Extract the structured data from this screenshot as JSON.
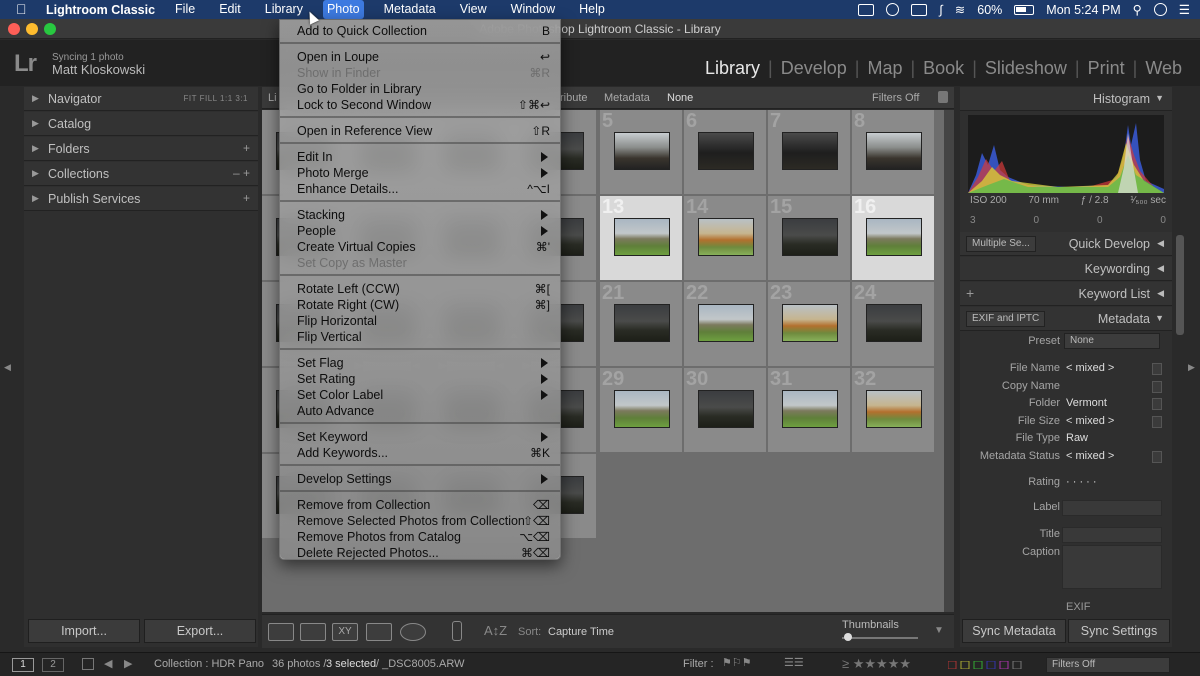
{
  "menubar": {
    "app": "Lightroom Classic",
    "items": [
      "File",
      "Edit",
      "Library",
      "Photo",
      "Metadata",
      "View",
      "Window",
      "Help"
    ],
    "battery": "60%",
    "clock": "Mon 5:24 PM"
  },
  "window": {
    "title": "Adobe Photoshop Lightroom Classic - Library"
  },
  "identity": {
    "logo": "Lr",
    "sync_status": "Syncing 1 photo",
    "user": "Matt Kloskowski"
  },
  "modules": [
    "Library",
    "Develop",
    "Map",
    "Book",
    "Slideshow",
    "Print",
    "Web"
  ],
  "left_panel": {
    "navigator": {
      "label": "Navigator",
      "zoom_options": "FIT   FILL   1:1   3:1"
    },
    "sections": [
      {
        "label": "Catalog",
        "extra": ""
      },
      {
        "label": "Folders",
        "extra": "+"
      },
      {
        "label": "Collections",
        "extra": "–  +"
      },
      {
        "label": "Publish Services",
        "extra": "+"
      }
    ],
    "import_label": "Import...",
    "export_label": "Export..."
  },
  "filter_bar": {
    "metadata_label": "Metadata",
    "none_label": "None",
    "filters_off": "Filters Off",
    "attribute_label": "ribute",
    "library_label": "Li"
  },
  "grid": {
    "cells": [
      {
        "n": "5",
        "t": "t-river",
        "sel": false
      },
      {
        "n": "6",
        "t": "t-dark",
        "sel": false
      },
      {
        "n": "7",
        "t": "t-dark",
        "sel": false
      },
      {
        "n": "8",
        "t": "t-river",
        "sel": false
      },
      {
        "n": "13",
        "t": "t-hill",
        "sel": true
      },
      {
        "n": "14",
        "t": "t-autumn",
        "sel": false
      },
      {
        "n": "15",
        "t": "t-dusk",
        "sel": false
      },
      {
        "n": "16",
        "t": "t-hill",
        "sel": true
      },
      {
        "n": "21",
        "t": "t-dusk",
        "sel": false
      },
      {
        "n": "22",
        "t": "t-hill",
        "sel": false
      },
      {
        "n": "23",
        "t": "t-autumn",
        "sel": false
      },
      {
        "n": "24",
        "t": "t-dusk",
        "sel": false
      },
      {
        "n": "29",
        "t": "t-hill",
        "sel": false
      },
      {
        "n": "30",
        "t": "t-dusk",
        "sel": false
      },
      {
        "n": "31",
        "t": "t-hill",
        "sel": false
      },
      {
        "n": "32",
        "t": "t-autumn",
        "sel": false
      }
    ]
  },
  "toolbar": {
    "sort_label": "Sort:",
    "sort_value": "Capture Time",
    "thumbnails_label": "Thumbnails"
  },
  "right_panel": {
    "histogram_label": "Histogram",
    "histo_info": {
      "iso": "ISO 200",
      "focal": "70 mm",
      "aperture": "ƒ / 2.8",
      "shutter": "¹⁄₅₀₀ sec"
    },
    "histo_counts": [
      "3",
      "0",
      "0",
      "0"
    ],
    "preset_select": "Multiple Se...",
    "quick_develop": "Quick Develop",
    "keywording": "Keywording",
    "keyword_list": "Keyword List",
    "metadata_select": "EXIF and IPTC",
    "metadata_label": "Metadata",
    "preset_label": "Preset",
    "preset_value": "None",
    "fields": [
      {
        "k": "File Name",
        "v": "< mixed >"
      },
      {
        "k": "Copy Name",
        "v": ""
      },
      {
        "k": "Folder",
        "v": "Vermont"
      },
      {
        "k": "File Size",
        "v": "< mixed >"
      },
      {
        "k": "File Type",
        "v": "Raw"
      },
      {
        "k": "Metadata Status",
        "v": "< mixed >"
      }
    ],
    "rating_label": "Rating",
    "rating_value": "·  ·  ·  ·  ·",
    "label_label": "Label",
    "title_label": "Title",
    "caption_label": "Caption",
    "exif_label": "EXIF",
    "sync_metadata": "Sync Metadata",
    "sync_settings": "Sync Settings"
  },
  "filmstrip": {
    "view1": "1",
    "view2": "2",
    "source": "Collection : HDR Pano",
    "count": "36 photos /",
    "selected": "3 selected",
    "file": "/ _DSC8005.ARW",
    "filter_label": "Filter :",
    "filters_off": "Filters Off"
  },
  "photo_menu": {
    "items": [
      {
        "label": "Add to Quick Collection",
        "shortcut": "B",
        "disabled": false,
        "sub": false,
        "sep_after": true
      },
      {
        "label": "Open in Loupe",
        "shortcut": "↩",
        "disabled": false,
        "sub": false,
        "sep_after": false
      },
      {
        "label": "Show in Finder",
        "shortcut": "⌘R",
        "disabled": true,
        "sub": false,
        "sep_after": false
      },
      {
        "label": "Go to Folder in Library",
        "shortcut": "",
        "disabled": false,
        "sub": false,
        "sep_after": false
      },
      {
        "label": "Lock to Second Window",
        "shortcut": "⇧⌘↩",
        "disabled": false,
        "sub": false,
        "sep_after": true
      },
      {
        "label": "Open in Reference View",
        "shortcut": "⇧R",
        "disabled": false,
        "sub": false,
        "sep_after": true
      },
      {
        "label": "Edit In",
        "shortcut": "",
        "disabled": false,
        "sub": true,
        "sep_after": false
      },
      {
        "label": "Photo Merge",
        "shortcut": "",
        "disabled": false,
        "sub": true,
        "sep_after": false
      },
      {
        "label": "Enhance Details...",
        "shortcut": "^⌥I",
        "disabled": false,
        "sub": false,
        "sep_after": true
      },
      {
        "label": "Stacking",
        "shortcut": "",
        "disabled": false,
        "sub": true,
        "sep_after": false
      },
      {
        "label": "People",
        "shortcut": "",
        "disabled": false,
        "sub": true,
        "sep_after": false
      },
      {
        "label": "Create Virtual Copies",
        "shortcut": "⌘'",
        "disabled": false,
        "sub": false,
        "sep_after": false
      },
      {
        "label": "Set Copy as Master",
        "shortcut": "",
        "disabled": true,
        "sub": false,
        "sep_after": true
      },
      {
        "label": "Rotate Left (CCW)",
        "shortcut": "⌘[",
        "disabled": false,
        "sub": false,
        "sep_after": false
      },
      {
        "label": "Rotate Right (CW)",
        "shortcut": "⌘]",
        "disabled": false,
        "sub": false,
        "sep_after": false
      },
      {
        "label": "Flip Horizontal",
        "shortcut": "",
        "disabled": false,
        "sub": false,
        "sep_after": false
      },
      {
        "label": "Flip Vertical",
        "shortcut": "",
        "disabled": false,
        "sub": false,
        "sep_after": true
      },
      {
        "label": "Set Flag",
        "shortcut": "",
        "disabled": false,
        "sub": true,
        "sep_after": false
      },
      {
        "label": "Set Rating",
        "shortcut": "",
        "disabled": false,
        "sub": true,
        "sep_after": false
      },
      {
        "label": "Set Color Label",
        "shortcut": "",
        "disabled": false,
        "sub": true,
        "sep_after": false
      },
      {
        "label": "Auto Advance",
        "shortcut": "",
        "disabled": false,
        "sub": false,
        "sep_after": true
      },
      {
        "label": "Set Keyword",
        "shortcut": "",
        "disabled": false,
        "sub": true,
        "sep_after": false
      },
      {
        "label": "Add Keywords...",
        "shortcut": "⌘K",
        "disabled": false,
        "sub": false,
        "sep_after": true
      },
      {
        "label": "Develop Settings",
        "shortcut": "",
        "disabled": false,
        "sub": true,
        "sep_after": true
      },
      {
        "label": "Remove from Collection",
        "shortcut": "⌫",
        "disabled": false,
        "sub": false,
        "sep_after": false
      },
      {
        "label": "Remove Selected Photos from Collection",
        "shortcut": "⇧⌫",
        "disabled": false,
        "sub": false,
        "sep_after": false
      },
      {
        "label": "Remove Photos from Catalog",
        "shortcut": "⌥⌫",
        "disabled": false,
        "sub": false,
        "sep_after": false
      },
      {
        "label": "Delete Rejected Photos...",
        "shortcut": "⌘⌫",
        "disabled": false,
        "sub": false,
        "sep_after": false
      }
    ]
  }
}
